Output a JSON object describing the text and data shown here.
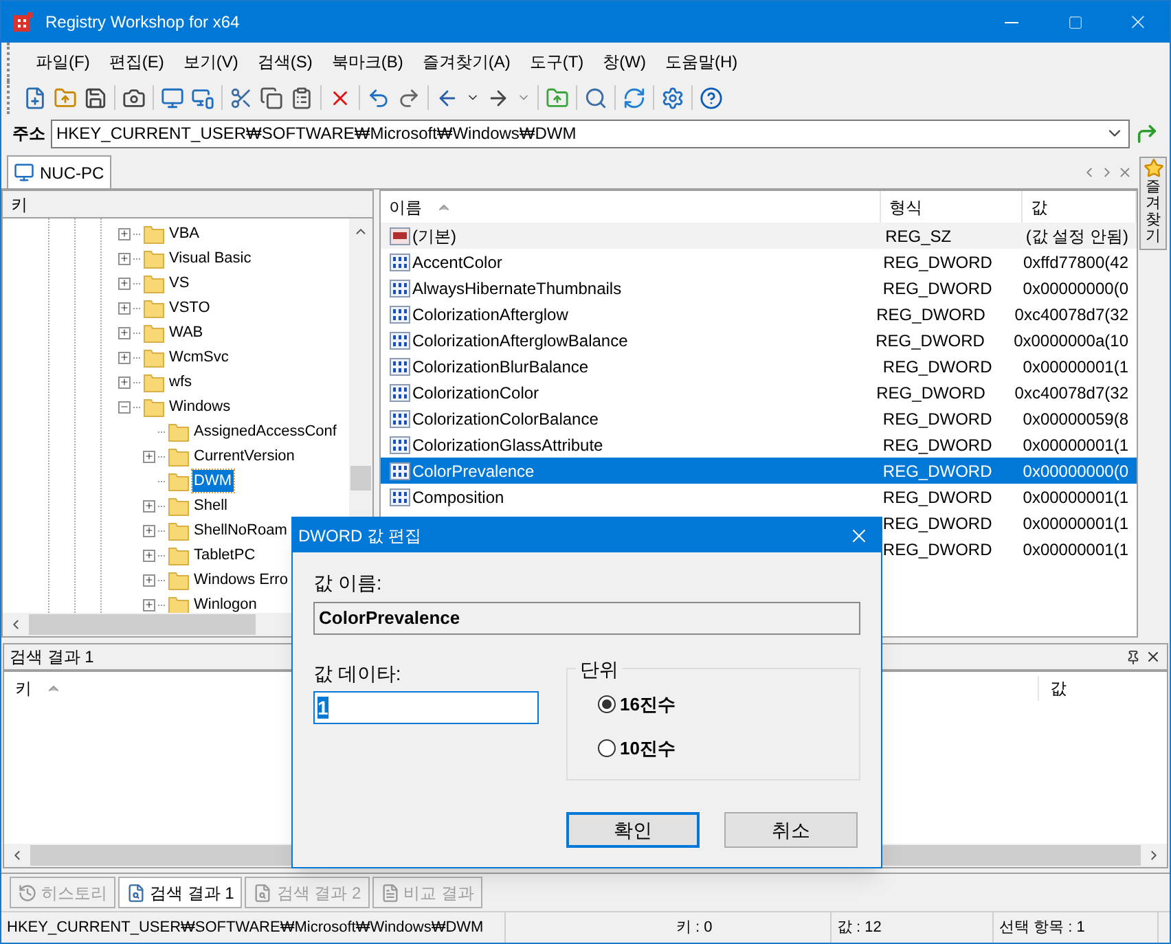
{
  "window": {
    "title": "Registry Workshop for x64"
  },
  "menu": [
    {
      "label": "파일(F)"
    },
    {
      "label": "편집(E)"
    },
    {
      "label": "보기(V)"
    },
    {
      "label": "검색(S)"
    },
    {
      "label": "북마크(B)"
    },
    {
      "label": "즐겨찾기(A)"
    },
    {
      "label": "도구(T)"
    },
    {
      "label": "창(W)"
    },
    {
      "label": "도움말(H)"
    }
  ],
  "address": {
    "label": "주소",
    "value": "HKEY_CURRENT_USER₩SOFTWARE₩Microsoft₩Windows₩DWM"
  },
  "tabs": [
    {
      "label": "NUC-PC",
      "selected": true
    }
  ],
  "tree": {
    "header": "키",
    "items": [
      {
        "label": "VBA",
        "kind": "collapsed",
        "selected": false
      },
      {
        "label": "Visual Basic",
        "kind": "collapsed",
        "selected": false
      },
      {
        "label": "VS",
        "kind": "collapsed",
        "selected": false
      },
      {
        "label": "VSTO",
        "kind": "collapsed",
        "selected": false
      },
      {
        "label": "WAB",
        "kind": "collapsed",
        "selected": false
      },
      {
        "label": "WcmSvc",
        "kind": "collapsed",
        "selected": false
      },
      {
        "label": "wfs",
        "kind": "collapsed",
        "selected": false
      },
      {
        "label": "Windows",
        "kind": "expanded",
        "selected": false,
        "children": [
          {
            "label": "AssignedAccessConf",
            "kind": "leaf",
            "selected": false
          },
          {
            "label": "CurrentVersion",
            "kind": "collapsed",
            "selected": false
          },
          {
            "label": "DWM",
            "kind": "leaf",
            "selected": true
          },
          {
            "label": "Shell",
            "kind": "collapsed",
            "selected": false
          },
          {
            "label": "ShellNoRoam",
            "kind": "collapsed",
            "selected": false
          },
          {
            "label": "TabletPC",
            "kind": "collapsed",
            "selected": false
          },
          {
            "label": "Windows Erro",
            "kind": "collapsed",
            "selected": false
          },
          {
            "label": "Winlogon",
            "kind": "collapsed",
            "selected": false
          }
        ]
      }
    ]
  },
  "list": {
    "columns": [
      {
        "label": "이름",
        "sorted": true
      },
      {
        "label": "형식",
        "sorted": false
      },
      {
        "label": "값",
        "sorted": false
      }
    ],
    "rows": [
      {
        "name": "(기본)",
        "type": "REG_SZ",
        "value": "(값 설정 안됨)",
        "kind": "string",
        "selected": false
      },
      {
        "name": "AccentColor",
        "type": "REG_DWORD",
        "value": "0xffd77800(42",
        "kind": "dword",
        "selected": false
      },
      {
        "name": "AlwaysHibernateThumbnails",
        "type": "REG_DWORD",
        "value": "0x00000000(0",
        "kind": "dword",
        "selected": false
      },
      {
        "name": "ColorizationAfterglow",
        "type": "REG_DWORD",
        "value": "0xc40078d7(32",
        "kind": "dword",
        "selected": false
      },
      {
        "name": "ColorizationAfterglowBalance",
        "type": "REG_DWORD",
        "value": "0x0000000a(10",
        "kind": "dword",
        "selected": false
      },
      {
        "name": "ColorizationBlurBalance",
        "type": "REG_DWORD",
        "value": "0x00000001(1",
        "kind": "dword",
        "selected": false
      },
      {
        "name": "ColorizationColor",
        "type": "REG_DWORD",
        "value": "0xc40078d7(32",
        "kind": "dword",
        "selected": false
      },
      {
        "name": "ColorizationColorBalance",
        "type": "REG_DWORD",
        "value": "0x00000059(8",
        "kind": "dword",
        "selected": false
      },
      {
        "name": "ColorizationGlassAttribute",
        "type": "REG_DWORD",
        "value": "0x00000001(1",
        "kind": "dword",
        "selected": false
      },
      {
        "name": "ColorPrevalence",
        "type": "REG_DWORD",
        "value": "0x00000000(0",
        "kind": "dword",
        "selected": true
      },
      {
        "name": "Composition",
        "type": "REG_DWORD",
        "value": "0x00000001(1",
        "kind": "dword",
        "selected": false
      },
      {
        "type": "REG_DWORD",
        "value": "0x00000001(1",
        "selected": false
      },
      {
        "type": "REG_DWORD",
        "value": "0x00000001(1",
        "selected": false
      }
    ]
  },
  "favorites": {
    "label": "즐겨찾기"
  },
  "search_panel": {
    "title": "검색 결과 1",
    "columns": [
      {
        "label": "키",
        "sorted": true
      },
      {
        "label": "값",
        "sorted": false
      }
    ]
  },
  "bottom_tabs": [
    {
      "label": "히스토리",
      "selected": false,
      "disabled": true
    },
    {
      "label": "검색 결과 1",
      "selected": true,
      "disabled": false
    },
    {
      "label": "검색 결과 2",
      "selected": false,
      "disabled": true
    },
    {
      "label": "비교 결과",
      "selected": false,
      "disabled": true
    }
  ],
  "status_bar": [
    "HKEY_CURRENT_USER₩SOFTWARE₩Microsoft₩Windows₩DWM",
    "키 : 0",
    "값 : 12",
    "선택 항목 : 1"
  ],
  "dialog": {
    "title": "DWORD 값 편집",
    "name_label": "값 이름:",
    "name_value": "ColorPrevalence",
    "data_label": "값 데이타:",
    "data_value": "1",
    "group": {
      "title": "단위",
      "options": [
        {
          "label": "16진수",
          "selected": true
        },
        {
          "label": "10진수",
          "selected": false
        }
      ]
    },
    "buttons": [
      {
        "label": "확인",
        "default": true
      },
      {
        "label": "취소",
        "default": false
      }
    ]
  }
}
